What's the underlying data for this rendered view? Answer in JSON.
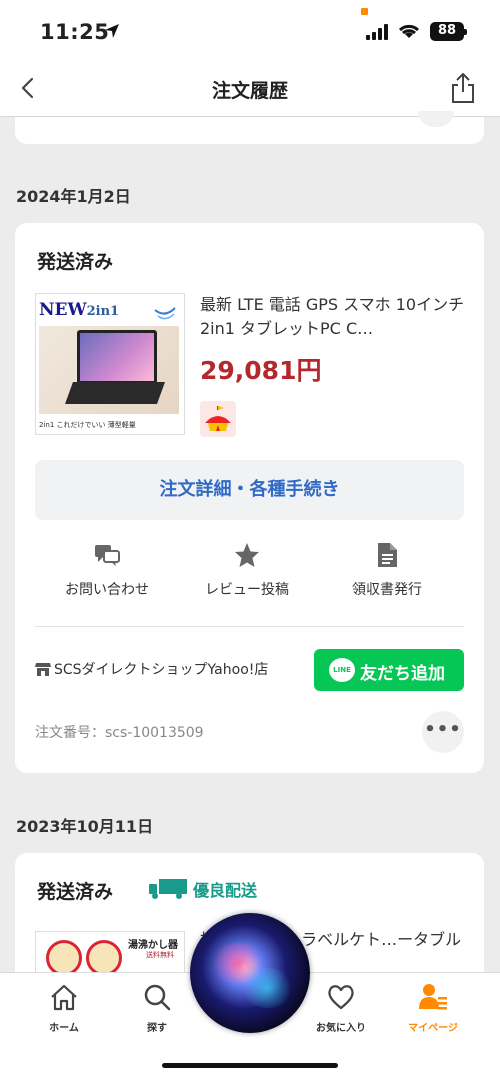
{
  "status_bar": {
    "time": "11:25",
    "battery": "88"
  },
  "nav": {
    "title": "注文履歴"
  },
  "orders": [
    {
      "date": "2024年1月2日",
      "status": "発送済み",
      "product_title": "最新 LTE 電話 GPS スマホ 10インチ 2in1 タブレットPC C…",
      "price": "29,081円",
      "thumb_text": {
        "badge": "NEW",
        "badge_small": "2in1",
        "caption": "2in1 これだけでいい 薄型軽量"
      },
      "detail_button": "注文詳細・各種手続き",
      "actions": {
        "inquiry": "お問い合わせ",
        "review": "レビュー投稿",
        "receipt": "領収書発行"
      },
      "store": "SCSダイレクトショップYahoo!店",
      "line_button": "友だち追加",
      "line_logo": "LINE",
      "order_number": "注文番号：scs-10013509"
    },
    {
      "date": "2023年10月11日",
      "status": "発送済み",
      "badge": "優良配送",
      "product_title": "折…ーター トラベルケト…ータブル電気浸…",
      "thumb_text": {
        "label": "湯沸かし器",
        "sub": "送料無料"
      }
    }
  ],
  "tabbar": {
    "home": "ホーム",
    "search": "探す",
    "favorites": "お気に入り",
    "mypage": "マイページ"
  },
  "colors": {
    "price": "#b3272d",
    "link": "#2f6ac6",
    "line_green": "#06c755",
    "accent": "#ff8a00",
    "yuryo": "#1a9a8a"
  }
}
